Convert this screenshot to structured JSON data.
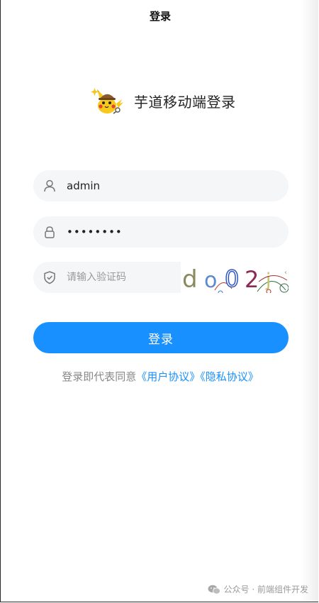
{
  "header": {
    "title": "登录"
  },
  "brand": {
    "logo_icon": "pikachu-mascot-icon",
    "text": "芋道移动端登录"
  },
  "form": {
    "username": {
      "icon": "user-icon",
      "value": "admin"
    },
    "password": {
      "icon": "lock-icon",
      "value": "••••••••"
    },
    "captcha": {
      "icon": "shield-check-icon",
      "placeholder": "请输入验证码",
      "image_text": "do02j"
    },
    "submit_label": "登录"
  },
  "agreement": {
    "prefix": "登录即代表同意",
    "user_agreement": "《用户协议》",
    "privacy_policy": "《隐私协议》"
  },
  "watermark": {
    "icon": "wechat-icon",
    "text": "公众号 · 前端组件开发"
  },
  "colors": {
    "primary": "#1890ff",
    "input_bg": "#f5f6f8",
    "muted_text": "#888888"
  }
}
